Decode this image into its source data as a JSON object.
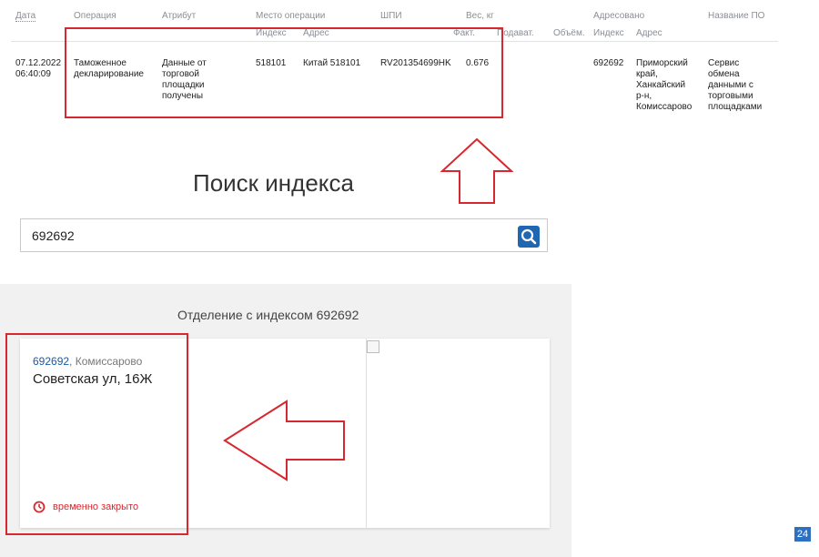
{
  "tracking": {
    "headers": {
      "date": "Дата",
      "operation": "Операция",
      "attribute": "Атрибут",
      "place": "Место операции",
      "place_index": "Индекс",
      "place_address": "Адрес",
      "barcode": "ШПИ",
      "weight": "Вес, кг",
      "weight_fact": "Факт.",
      "weight_declared": "Подават.",
      "volume": "Объём.",
      "addressed": "Адресовано",
      "addr_index": "Индекс",
      "addr_address": "Адрес",
      "software": "Название ПО"
    },
    "row": {
      "date": "07.12.2022",
      "time": "06:40:09",
      "operation": [
        "Таможенное",
        "декларирование"
      ],
      "attribute": [
        "Данные от",
        "торговой",
        "площадки",
        "получены"
      ],
      "place_index": "518101",
      "place_address": "Китай 518101",
      "barcode": "RV201354699HK",
      "weight": "0.676",
      "addr_index": "692692",
      "addr_address": [
        "Приморский",
        "край,",
        "Ханкайский",
        "р-н,",
        "Комиссарово"
      ],
      "software": [
        "Сервис",
        "обмена",
        "данными с",
        "торговыми",
        "площадками"
      ]
    }
  },
  "search": {
    "title": "Поиск индекса",
    "value": "692692",
    "button_icon": "search-icon"
  },
  "results": {
    "title": "Отделение с индексом 692692",
    "card": {
      "index": "692692",
      "city": ", Комиссарово",
      "address": "Советская ул, 16Ж",
      "status": "временно закрыто",
      "status_icon": "clock-icon"
    }
  },
  "page_number": "24",
  "colors": {
    "accent": "#1f66b3",
    "highlight": "#d6282e",
    "link": "#1a5aa6"
  }
}
